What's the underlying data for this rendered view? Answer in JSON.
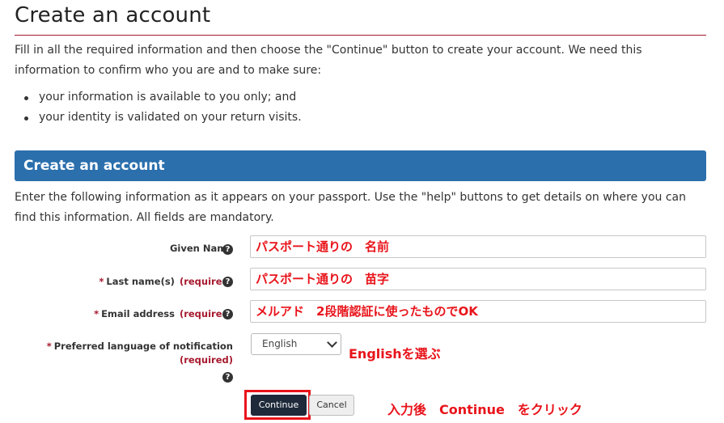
{
  "page": {
    "title": "Create an account",
    "intro": "Fill in all the required information and then choose the \"Continue\" button to create your account. We need this information to confirm who you are and to make sure:",
    "bullets": [
      "your information is available to you only; and",
      "your identity is validated on your return visits."
    ]
  },
  "section": {
    "header": "Create an account",
    "intro": "Enter the following information as it appears on your passport. Use the \"help\" buttons to get details on where you can find this information. All fields are mandatory."
  },
  "form": {
    "given_name": {
      "label": "Given Name",
      "value": "パスポート通りの　名前"
    },
    "last_name": {
      "star": "*",
      "label": "Last name(s)",
      "required": "(required)",
      "value": "パスポート通りの　苗字"
    },
    "email": {
      "star": "*",
      "label": "Email address",
      "required": "(required)",
      "value": "メルアド　2段階認証に使ったものでOK"
    },
    "language": {
      "star": "*",
      "label": "Preferred language of notification",
      "required": "(required)",
      "selected": "English",
      "annotation": "Englishを選ぶ"
    },
    "help_icon_glyph": "?"
  },
  "buttons": {
    "continue": "Continue",
    "cancel": "Cancel",
    "annotation": "入力後　Continue　をクリック"
  },
  "colors": {
    "accent": "#2b6fad",
    "required": "#a6192e",
    "annotation": "#e8141b",
    "primary_button": "#1e2a3a"
  }
}
